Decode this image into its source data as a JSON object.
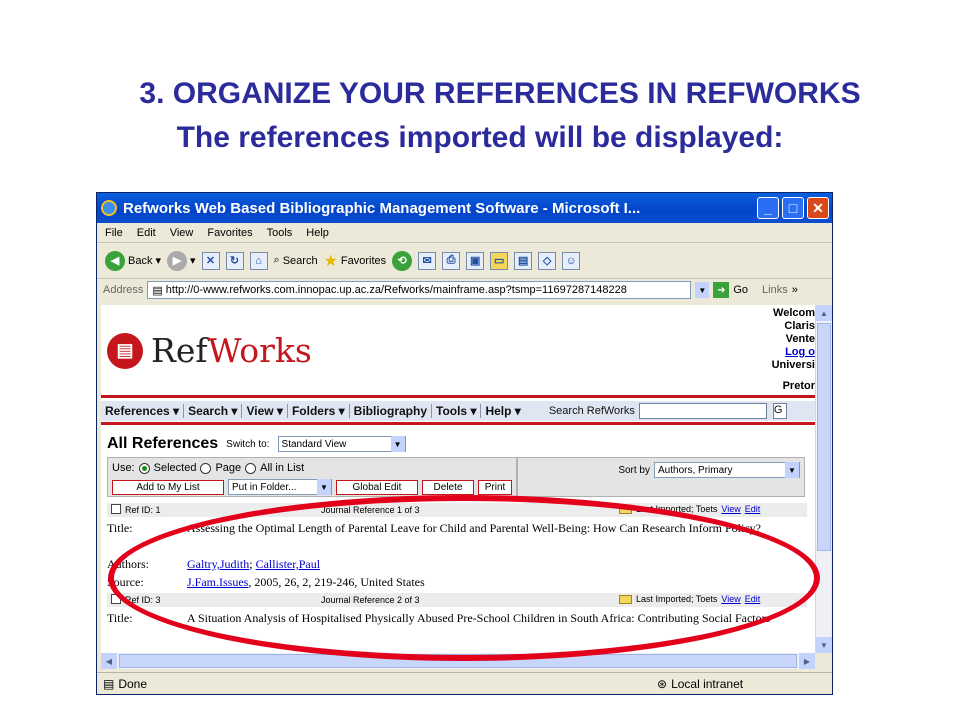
{
  "slide": {
    "title_line1": "3. ORGANIZE YOUR REFERENCES IN REFWORKS",
    "title_line2": "The references imported will be displayed:"
  },
  "window": {
    "title": "Refworks Web Based Bibliographic Management Software - Microsoft I...",
    "menu": [
      "File",
      "Edit",
      "View",
      "Favorites",
      "Tools",
      "Help"
    ],
    "toolbar": {
      "back": "Back",
      "search": "Search",
      "favorites": "Favorites"
    },
    "address_label": "Address",
    "address": "http://0-www.refworks.com.innopac.up.ac.za/Refworks/mainframe.asp?tsmp=11697287148228",
    "go": "Go",
    "links": "Links",
    "status": "Done",
    "zone": "Local intranet"
  },
  "refworks": {
    "logo_ref": "Ref",
    "logo_works": "Works",
    "welcome": [
      "Welcom",
      "Claris",
      "Vente",
      "Log o",
      "Universi",
      "Pretor"
    ],
    "menu": [
      "References ▾",
      "Search ▾",
      "View ▾",
      "Folders ▾",
      "Bibliography",
      "Tools ▾",
      "Help ▾"
    ],
    "search_label": "Search RefWorks",
    "search_go": "G",
    "heading": "All References",
    "switch_to": "Switch to:",
    "view_select": "Standard View",
    "use_label": "Use:",
    "use_options": [
      "Selected",
      "Page",
      "All in List"
    ],
    "buttons": {
      "add": "Add to My List",
      "folder": "Put in Folder...",
      "edit": "Global Edit",
      "delete": "Delete",
      "print": "Print"
    },
    "sort_label": "Sort by",
    "sort_value": "Authors, Primary",
    "references": [
      {
        "ref_id": "Ref ID: 1",
        "journal": "Journal Reference 1 of 3",
        "last": "Last Imported; Toets",
        "view": "View",
        "edit": "Edit",
        "title_label": "Title:",
        "title": "Assessing the Optimal Length of Parental Leave for Child and Parental Well-Being: How Can Research Inform Policy?",
        "authors_label": "Authors:",
        "author1": "Galtry,Judith",
        "author2": "Callister,Paul",
        "source_label": "Source:",
        "source_journal": "J.Fam.Issues",
        "source_rest": ", 2005, 26, 2, 219-246, United States"
      },
      {
        "ref_id": "Ref ID: 3",
        "journal": "Journal Reference 2 of 3",
        "last": "Last Imported; Toets",
        "view": "View",
        "edit": "Edit",
        "title_label": "Title:",
        "title": "A Situation Analysis of Hospitalised Physically Abused Pre-School Children in South Africa: Contributing Social Factors"
      }
    ]
  },
  "colors": {
    "title_blue": "#2b2b9b",
    "refworks_red": "#c4161c",
    "highlight_oval": "#e3001b"
  }
}
